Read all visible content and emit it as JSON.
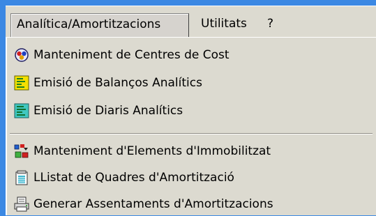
{
  "menubar": {
    "items": [
      {
        "label": "Analítica/Amortitzacions"
      },
      {
        "label": "Utilitats"
      },
      {
        "label": "?"
      }
    ]
  },
  "dropdown": {
    "items": [
      {
        "label": "Manteniment de Centres de Cost",
        "icon": "cost-centres-icon"
      },
      {
        "label": "Emisió de Balanços Analítics",
        "icon": "document-yellow-icon"
      },
      {
        "label": "Emisió de Diaris Analítics",
        "icon": "document-teal-icon"
      },
      {
        "label": "Manteniment d'Elements d'Immobilitzat",
        "icon": "assets-icon"
      },
      {
        "label": "LListat de Quadres d'Amortització",
        "icon": "list-report-icon"
      },
      {
        "label": "Generar Assentaments d'Amortitzacions",
        "icon": "print-entries-icon"
      }
    ]
  },
  "colors": {
    "desktop": "#3b88e3",
    "menu_bg": "#dcdad0"
  }
}
